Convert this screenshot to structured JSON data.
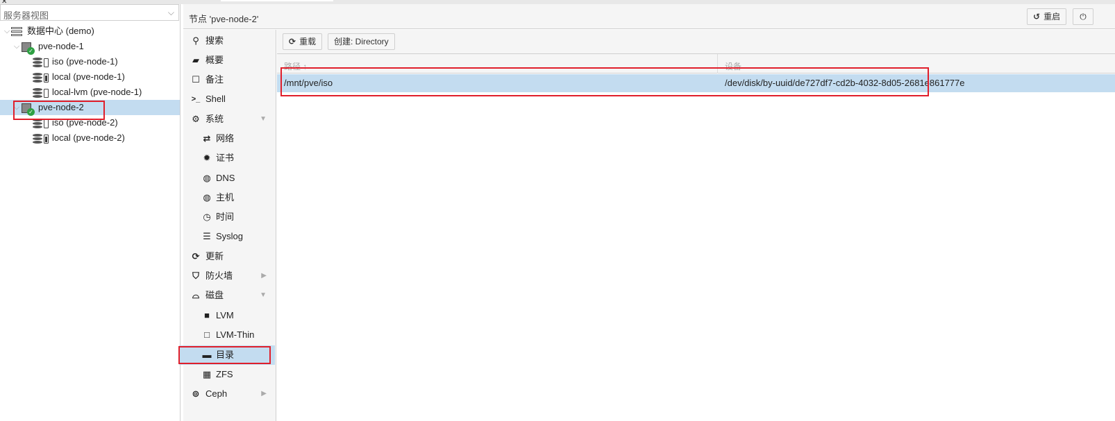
{
  "tree": {
    "view_label": "服务器视图",
    "items": [
      {
        "label": "数据中心 (demo)",
        "icon": "datacenter-icon"
      },
      {
        "label": "pve-node-1",
        "icon": "node-online-icon"
      },
      {
        "label": "iso (pve-node-1)",
        "icon": "storage-icon"
      },
      {
        "label": "local (pve-node-1)",
        "icon": "storage-icon"
      },
      {
        "label": "local-lvm (pve-node-1)",
        "icon": "storage-icon"
      },
      {
        "label": "pve-node-2",
        "icon": "node-online-icon"
      },
      {
        "label": "iso (pve-node-2)",
        "icon": "storage-icon"
      },
      {
        "label": "local (pve-node-2)",
        "icon": "storage-icon"
      }
    ]
  },
  "header": {
    "title": "节点 'pve-node-2'",
    "reboot_label": "重启"
  },
  "nav": {
    "items": [
      {
        "label": "搜索",
        "icon": "search-icon"
      },
      {
        "label": "概要",
        "icon": "book-icon"
      },
      {
        "label": "备注",
        "icon": "note-icon"
      },
      {
        "label": "Shell",
        "icon": "terminal-icon"
      },
      {
        "label": "系统",
        "icon": "gears-icon"
      },
      {
        "label": "网络",
        "icon": "exchange-icon"
      },
      {
        "label": "证书",
        "icon": "certificate-icon"
      },
      {
        "label": "DNS",
        "icon": "globe-icon"
      },
      {
        "label": "主机",
        "icon": "globe-icon"
      },
      {
        "label": "时间",
        "icon": "clock-icon"
      },
      {
        "label": "Syslog",
        "icon": "list-icon"
      },
      {
        "label": "更新",
        "icon": "refresh-icon"
      },
      {
        "label": "防火墙",
        "icon": "shield-icon"
      },
      {
        "label": "磁盘",
        "icon": "hdd-icon"
      },
      {
        "label": "LVM",
        "icon": "square-icon"
      },
      {
        "label": "LVM-Thin",
        "icon": "square-outline-icon"
      },
      {
        "label": "目录",
        "icon": "folder-icon"
      },
      {
        "label": "ZFS",
        "icon": "th-large-icon"
      },
      {
        "label": "Ceph",
        "icon": "ceph-icon"
      }
    ]
  },
  "toolbar": {
    "reload_label": "重载",
    "create_label": "创建: Directory"
  },
  "grid": {
    "columns": [
      "路径 ↑",
      "设备"
    ],
    "rows": [
      {
        "path": "/mnt/pve/iso",
        "device": "/dev/disk/by-uuid/de727df7-cd2b-4032-8d05-2681e861777e"
      }
    ]
  },
  "colors": {
    "selection": "#c3dcf0",
    "highlight_box": "#e01e2a",
    "status_ok": "#2ea043"
  }
}
